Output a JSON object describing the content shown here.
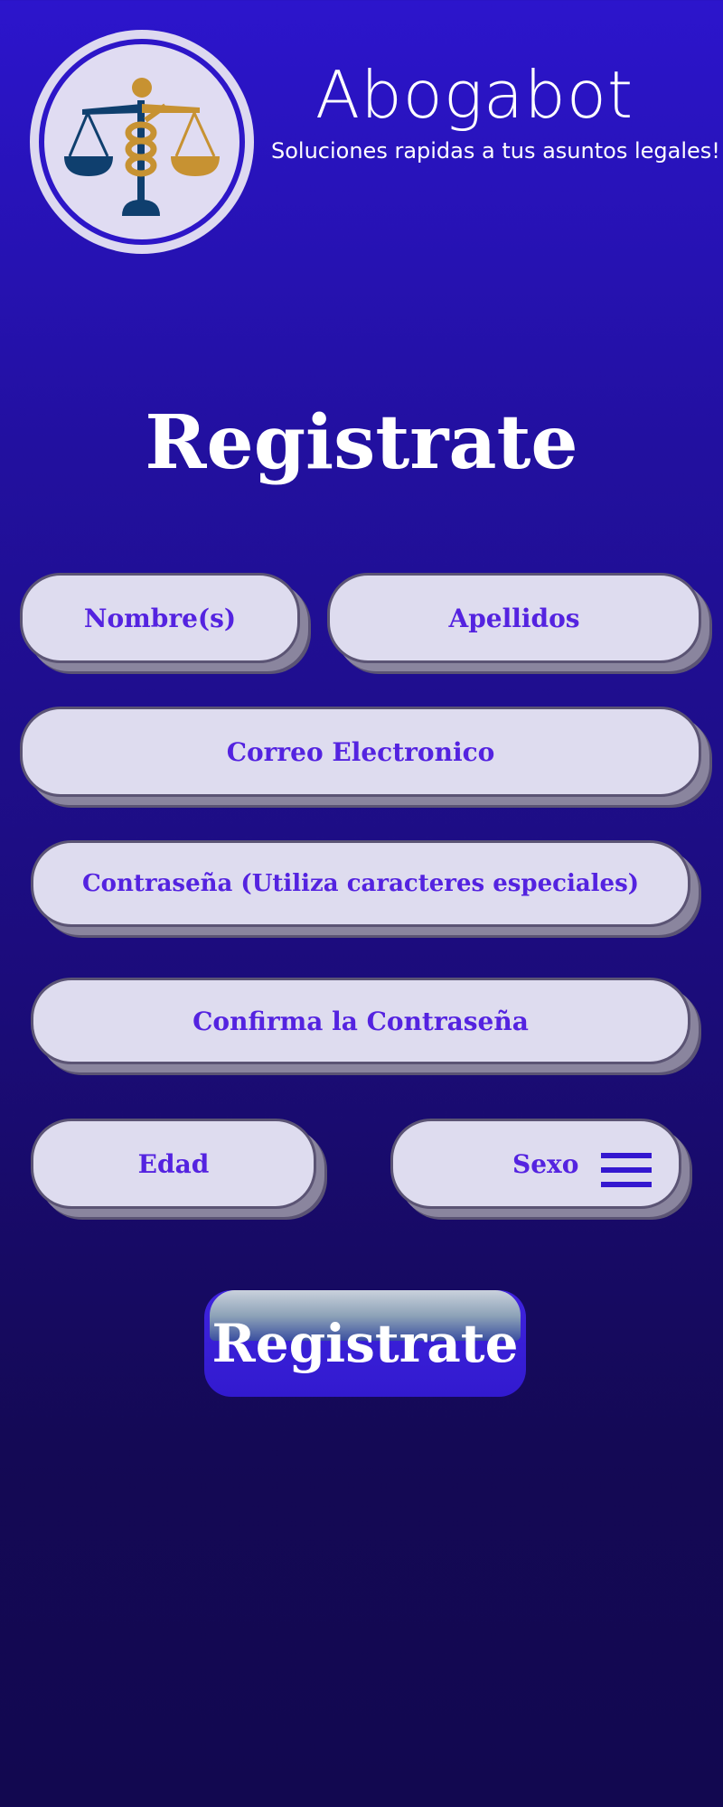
{
  "header": {
    "app_title": "Abogabot",
    "tagline": "Soluciones rapidas a tus asuntos legales!!",
    "logo_icon": "scales-of-justice-icon"
  },
  "main": {
    "heading": "Registrate"
  },
  "form": {
    "nombre_placeholder": "Nombre(s)",
    "apellidos_placeholder": "Apellidos",
    "correo_placeholder": "Correo Electronico",
    "password_placeholder": "Contraseña (Utiliza caracteres especiales)",
    "confirm_placeholder": "Confirma la Contraseña",
    "edad_placeholder": "Edad",
    "sexo_label": "Sexo",
    "sexo_icon": "menu-icon",
    "submit_label": "Registrate"
  },
  "colors": {
    "background_top": "#2c15cc",
    "background_bottom": "#120850",
    "field_bg": "#dedcef",
    "field_text": "#5423e0",
    "logo_gold": "#c79232",
    "logo_navy": "#0f3f6e"
  }
}
